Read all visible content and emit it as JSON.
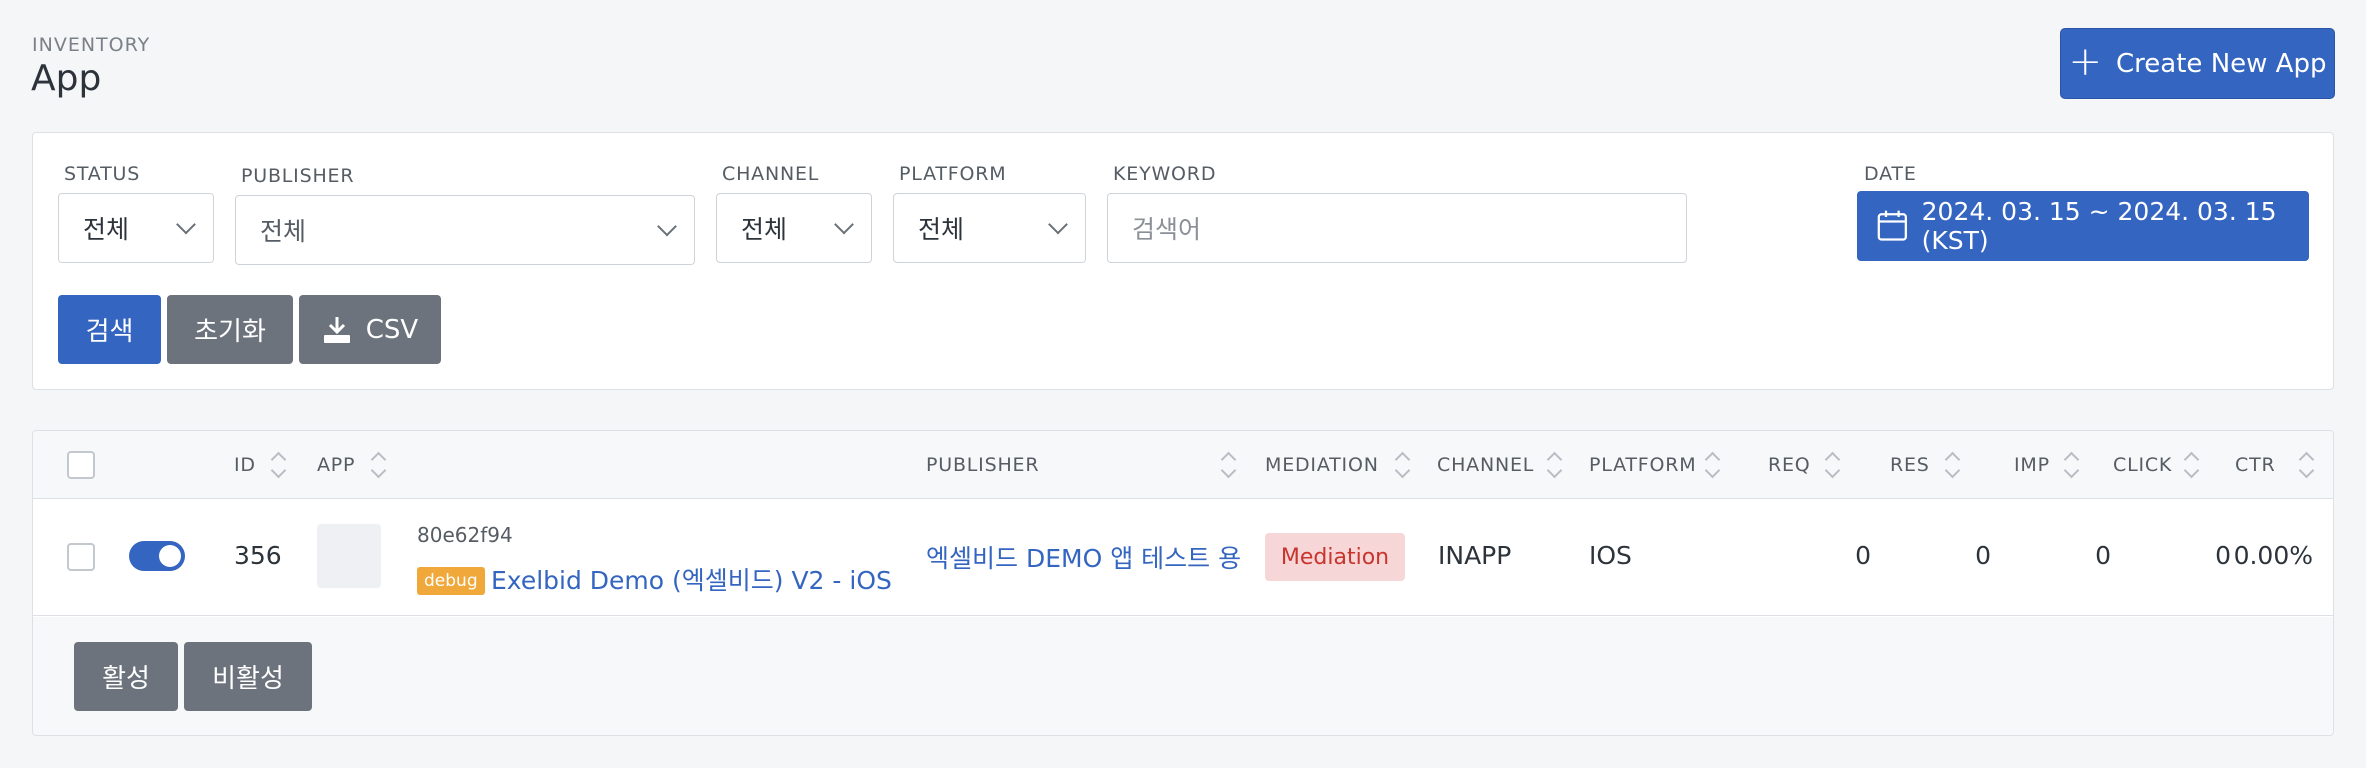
{
  "header": {
    "breadcrumb": "INVENTORY",
    "title": "App",
    "create_button": "Create New App"
  },
  "filters": {
    "status": {
      "label": "STATUS",
      "value": "전체"
    },
    "publisher": {
      "label": "PUBLISHER",
      "value": "전체"
    },
    "channel": {
      "label": "CHANNEL",
      "value": "전체"
    },
    "platform": {
      "label": "PLATFORM",
      "value": "전체"
    },
    "keyword": {
      "label": "KEYWORD",
      "placeholder": "검색어"
    },
    "date": {
      "label": "DATE",
      "value": "2024. 03. 15 ~ 2024. 03. 15 (KST)"
    },
    "search_button": "검색",
    "reset_button": "초기화",
    "csv_button": "CSV"
  },
  "table": {
    "columns": {
      "id": "ID",
      "app": "APP",
      "publisher": "PUBLISHER",
      "mediation": "MEDIATION",
      "channel": "CHANNEL",
      "platform": "PLATFORM",
      "req": "REQ",
      "res": "RES",
      "imp": "IMP",
      "click": "CLICK",
      "ctr": "CTR"
    },
    "rows": [
      {
        "id": "356",
        "enabled": true,
        "app_hash": "80e62f94",
        "badge": "debug",
        "app_name": "Exelbid Demo (엑셀비드) V2 - iOS",
        "publisher": "엑셀비드 DEMO 앱 테스트 용",
        "mediation": "Mediation",
        "channel": "INAPP",
        "platform": "IOS",
        "req": "0",
        "res": "0",
        "imp": "0",
        "click": "0",
        "ctr": "0.00%"
      }
    ],
    "activate_button": "활성",
    "deactivate_button": "비활성"
  },
  "colors": {
    "primary": "#3465c0",
    "secondary": "#6c737c",
    "debug_badge": "#f0a83a",
    "mediation_badge_bg": "#f6d6d6",
    "mediation_badge_text": "#c8352f"
  },
  "icons": {
    "create": "plus-icon",
    "select": "chevron-down-icon",
    "date": "calendar-icon",
    "csv": "download-icon",
    "sort": "sort-icon"
  }
}
